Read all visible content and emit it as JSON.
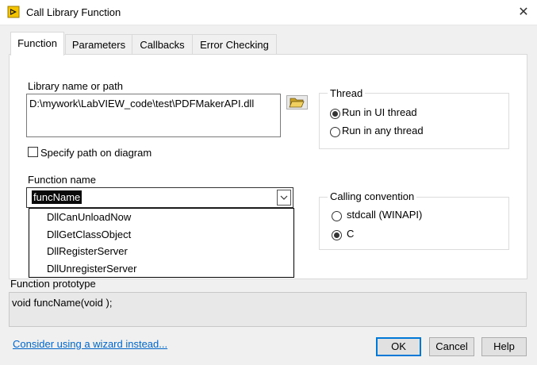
{
  "window": {
    "title": "Call Library Function",
    "close_glyph": "✕",
    "icon": "labview-icon"
  },
  "tabs": [
    {
      "label": "Function",
      "active": true
    },
    {
      "label": "Parameters",
      "active": false
    },
    {
      "label": "Callbacks",
      "active": false
    },
    {
      "label": "Error Checking",
      "active": false
    }
  ],
  "library": {
    "label": "Library name or path",
    "value": "D:\\mywork\\LabVIEW_code\\test\\PDFMakerAPI.dll",
    "browse_icon": "folder-open-icon",
    "specify_path_label": "Specify path on diagram",
    "specify_path_checked": false
  },
  "function": {
    "label": "Function name",
    "value": "funcName",
    "options": [
      "DllCanUnloadNow",
      "DllGetClassObject",
      "DllRegisterServer",
      "DllUnregisterServer"
    ]
  },
  "thread": {
    "title": "Thread",
    "options": [
      {
        "label": "Run in UI thread",
        "selected": true
      },
      {
        "label": "Run in any thread",
        "selected": false
      }
    ]
  },
  "calling_convention": {
    "title": "Calling convention",
    "options": [
      {
        "label": "stdcall (WINAPI)",
        "selected": false
      },
      {
        "label": "C",
        "selected": true
      }
    ]
  },
  "prototype": {
    "label": "Function prototype",
    "value": "void  funcName(void );"
  },
  "footer": {
    "wizard_link": "Consider using a wizard instead...",
    "ok": "OK",
    "cancel": "Cancel",
    "help": "Help"
  },
  "colors": {
    "accent": "#0078d7",
    "link": "#0066cc",
    "dialog_bg": "#f0f0f0"
  }
}
